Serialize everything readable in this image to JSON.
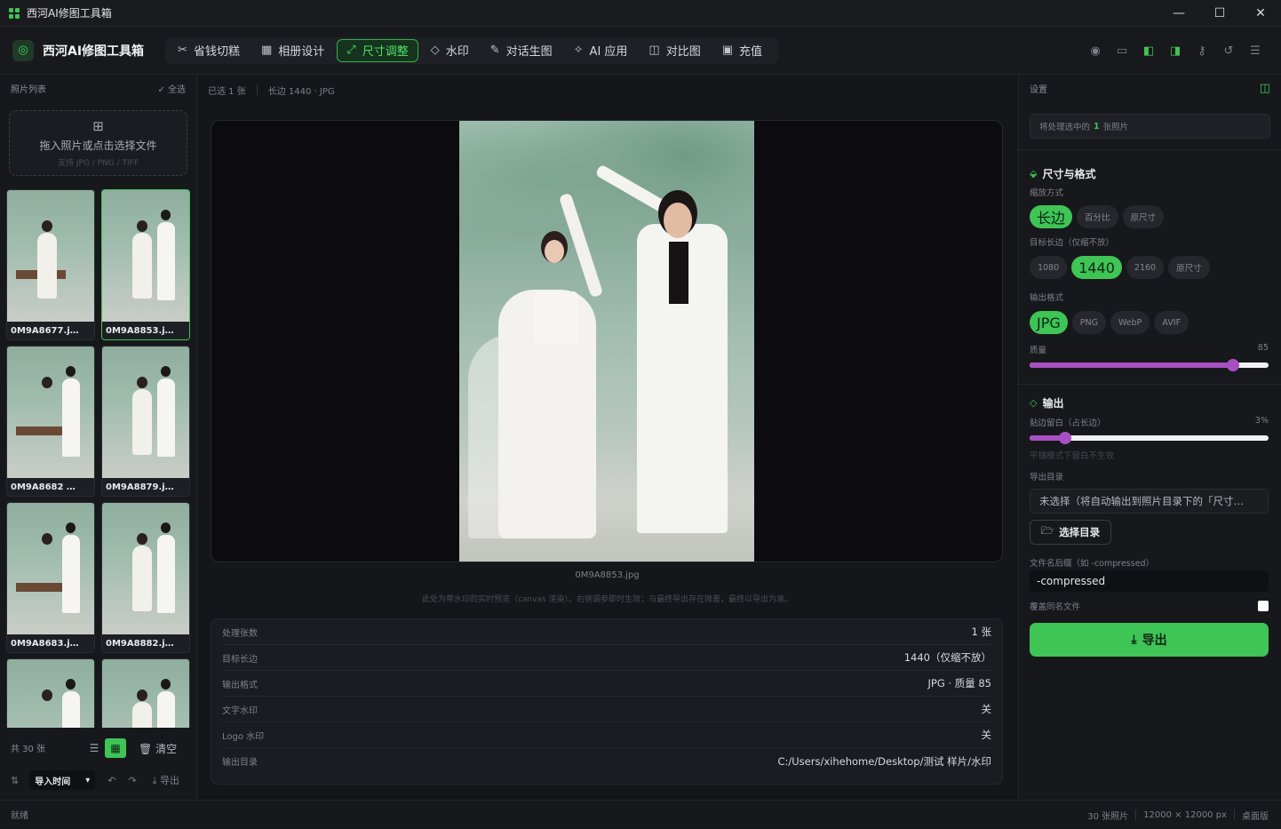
{
  "window": {
    "title": "西河AI修图工具箱",
    "minimize": "—",
    "maximize": "☐",
    "close": "✕"
  },
  "brand": {
    "name": "西河AI修图工具箱",
    "icon": "camera-icon"
  },
  "tabs": [
    {
      "label": "省钱切糕",
      "icon": "scissors-icon",
      "glyph": "✂"
    },
    {
      "label": "相册设计",
      "icon": "grid-icon",
      "glyph": "▦"
    },
    {
      "label": "尺寸调整",
      "icon": "resize-icon",
      "glyph": "⤢",
      "active": true
    },
    {
      "label": "水印",
      "icon": "drop-icon",
      "glyph": "◇"
    },
    {
      "label": "对话生图",
      "icon": "wand-icon",
      "glyph": "✎"
    },
    {
      "label": "AI 应用",
      "icon": "sparkle-icon",
      "glyph": "✧"
    },
    {
      "label": "对比图",
      "icon": "compare-icon",
      "glyph": "◫"
    },
    {
      "label": "充值",
      "icon": "wallet-icon",
      "glyph": "▣"
    }
  ],
  "left": {
    "header": "照片列表",
    "select_all": "✓ 全选",
    "drop_title": "拖入照片或点击选择文件",
    "drop_hint": "支持 JPG / PNG / TIFF",
    "thumbnails": [
      {
        "name": "0M9A8677.j…"
      },
      {
        "name": "0M9A8853.j…",
        "selected": true
      },
      {
        "name": "0M9A8682 …"
      },
      {
        "name": "0M9A8879.j…"
      },
      {
        "name": "0M9A8683.j…"
      },
      {
        "name": "0M9A8882.j…"
      },
      {
        "name": ""
      },
      {
        "name": ""
      }
    ],
    "count": "共 30 张",
    "clear": "清空",
    "sort_label": "导入时间",
    "export_label": "导出"
  },
  "center": {
    "selected": "已选 1 张",
    "meta": "长边 1440 · JPG",
    "filename": "0M9A8853.jpg",
    "note": "此处为带水印的实时预览（canvas 渲染）。右侧调参即时生效；与最终导出存在微差，最终以导出为准。",
    "summary": [
      {
        "k": "处理张数",
        "v": "1 张"
      },
      {
        "k": "目标长边",
        "v": "1440（仅缩不放）"
      },
      {
        "k": "输出格式",
        "v": "JPG · 质量 85"
      },
      {
        "k": "文字水印",
        "v": "关"
      },
      {
        "k": "Logo 水印",
        "v": "关"
      },
      {
        "k": "输出目录",
        "v": "C:/Users/xihehome/Desktop/测试 样片/水印"
      }
    ]
  },
  "right": {
    "header": "设置",
    "selinfo_pre": "将处理选中的",
    "selinfo_num": "1",
    "selinfo_post": "张照片",
    "size_section": "尺寸与格式",
    "scale_label": "缩放方式",
    "scale_options": [
      "长边",
      "百分比",
      "原尺寸"
    ],
    "target_label": "目标长边（仅缩不放）",
    "target_options": [
      "1080",
      "1440",
      "2160",
      "原尺寸"
    ],
    "format_label": "输出格式",
    "format_options": [
      "JPG",
      "PNG",
      "WebP",
      "AVIF"
    ],
    "quality_label": "质量",
    "quality_value": "85",
    "quality": 85,
    "output_section": "输出",
    "margin_label": "贴边留白（占长边）",
    "margin_value": "3%",
    "margin": 0.03,
    "margin_note": "平铺模式下留白不生效",
    "dir_label": "导出目录",
    "dir_value": "未选择（将自动输出到照片目录下的「尺寸…",
    "pick_btn": "选择目录",
    "suffix_label": "文件名后缀（如 -compressed）",
    "suffix_value": "-compressed",
    "overwrite_label": "覆盖同名文件",
    "export_btn": "导出"
  },
  "status": {
    "left": "就绪",
    "photos": "30 张照片",
    "size": "12000 × 12000 px",
    "edition": "桌面版"
  },
  "colors": {
    "accent": "#3fc456",
    "slider": "#a84fc4"
  }
}
